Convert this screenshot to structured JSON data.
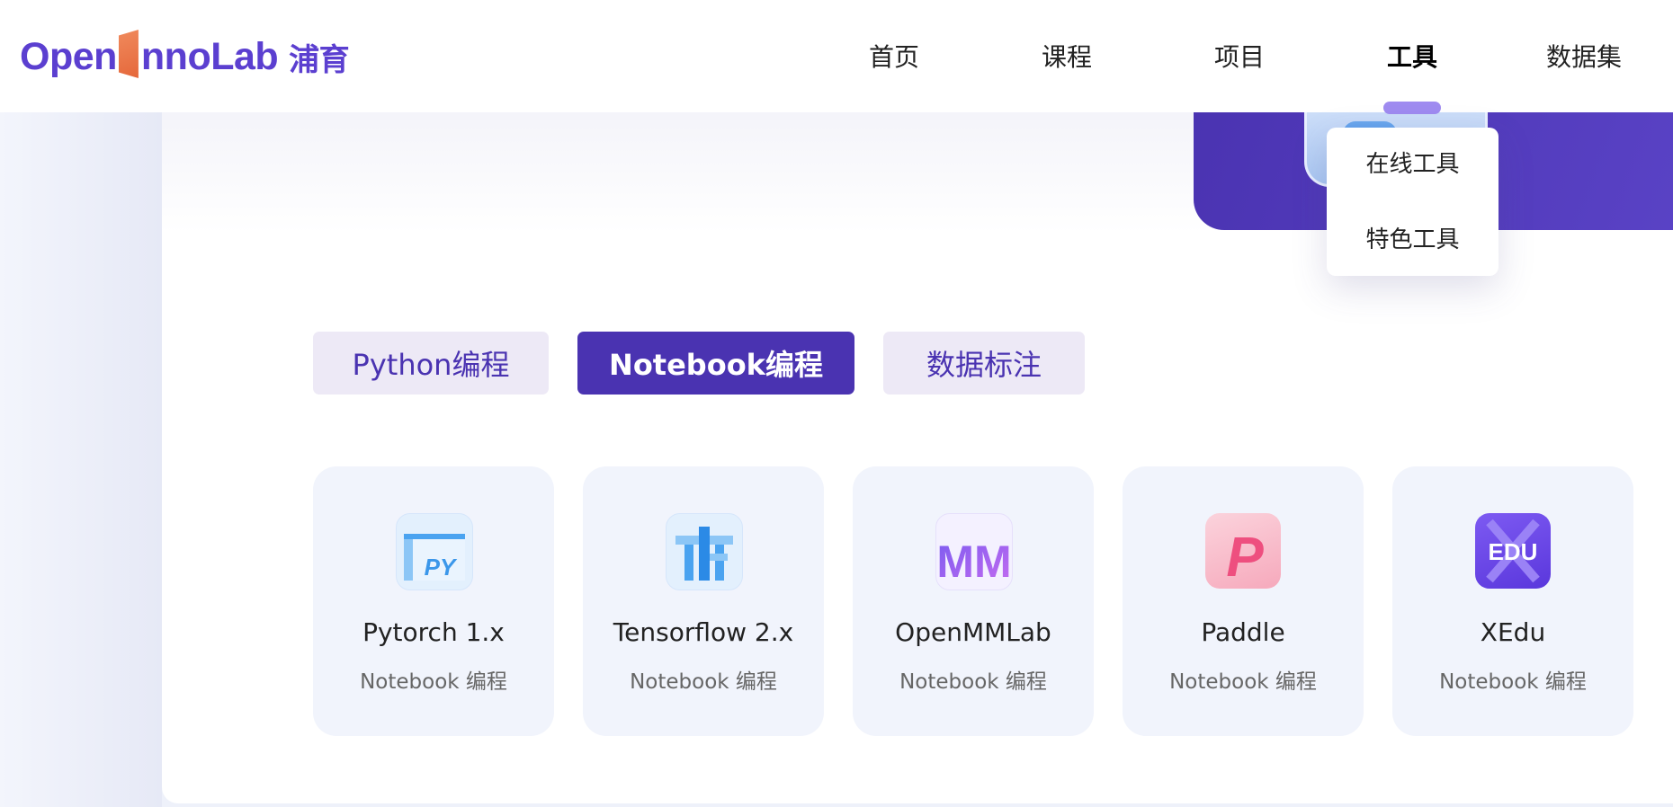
{
  "header": {
    "logo_text_a": "Open",
    "logo_text_b": "nnoLab",
    "logo_text_cn": "浦育"
  },
  "nav": {
    "items": [
      {
        "label": "首页"
      },
      {
        "label": "课程"
      },
      {
        "label": "项目"
      },
      {
        "label": "工具",
        "active": true
      },
      {
        "label": "数据集"
      }
    ]
  },
  "dropdown": {
    "items": [
      {
        "label": "在线工具"
      },
      {
        "label": "特色工具"
      }
    ]
  },
  "tabs": [
    {
      "label": "Python编程",
      "active": false
    },
    {
      "label": "Notebook编程",
      "active": true
    },
    {
      "label": "数据标注",
      "active": false
    }
  ],
  "tools": [
    {
      "name": "Pytorch 1.x",
      "subtitle": "Notebook 编程",
      "icon": "pytorch-py-icon",
      "icon_text": "PY"
    },
    {
      "name": "Tensorflow 2.x",
      "subtitle": "Notebook 编程",
      "icon": "tensorflow-icon"
    },
    {
      "name": "OpenMMLab",
      "subtitle": "Notebook 编程",
      "icon": "openmmlab-icon",
      "icon_text": "MM"
    },
    {
      "name": "Paddle",
      "subtitle": "Notebook 编程",
      "icon": "paddle-icon",
      "icon_text": "P"
    },
    {
      "name": "XEdu",
      "subtitle": "Notebook 编程",
      "icon": "xedu-icon",
      "icon_text": "EDU"
    }
  ],
  "colors": {
    "brand": "#4a33b1",
    "logo": "#5b3fd0",
    "logo_accent": "#e5673a",
    "tab_inactive_bg": "#ede9f6",
    "card_bg": "#f1f4fc"
  }
}
